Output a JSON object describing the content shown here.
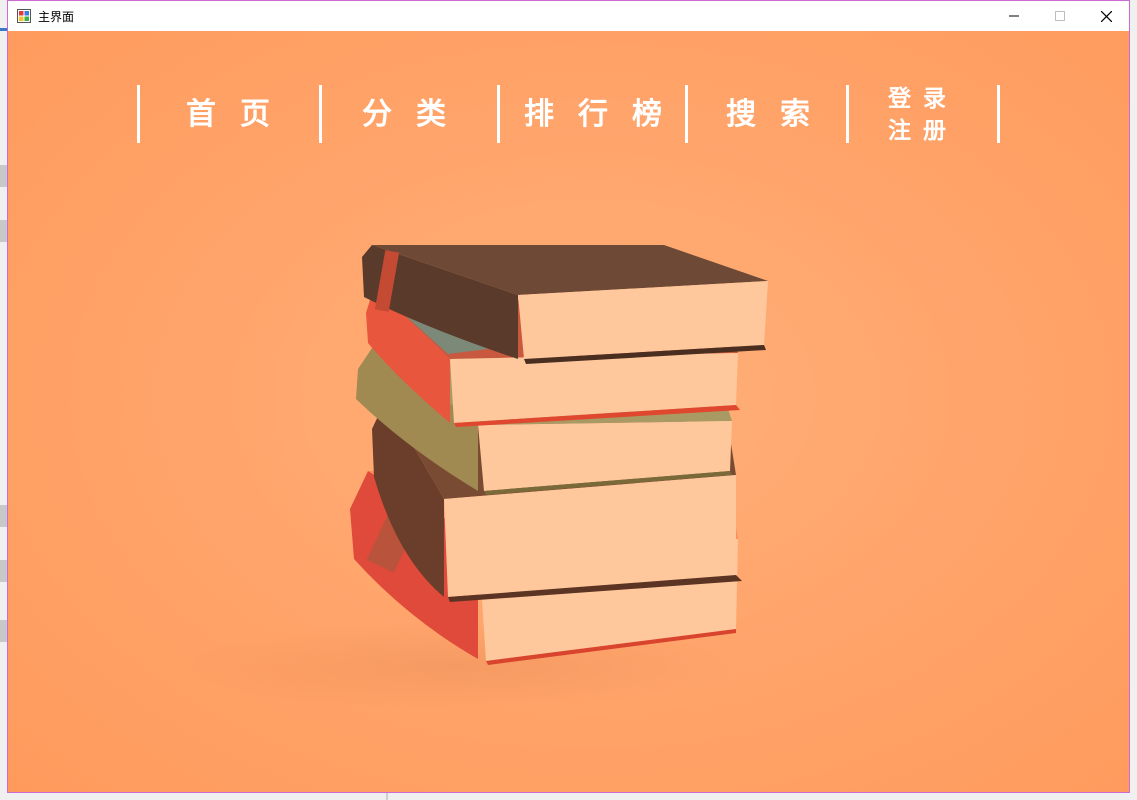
{
  "window": {
    "title": "主界面",
    "controls": {
      "minimize_icon": "minimize-icon",
      "maximize_icon": "maximize-icon",
      "close_icon": "close-icon"
    }
  },
  "nav": {
    "home": "首页",
    "category": "分类",
    "ranking": "排行榜",
    "search": "搜索",
    "login": "登录",
    "register": "注册"
  },
  "colors": {
    "background": "#ffa46b",
    "nav_text": "#ffffff",
    "window_border": "#c96bd0"
  },
  "illustration": "stack-of-books"
}
